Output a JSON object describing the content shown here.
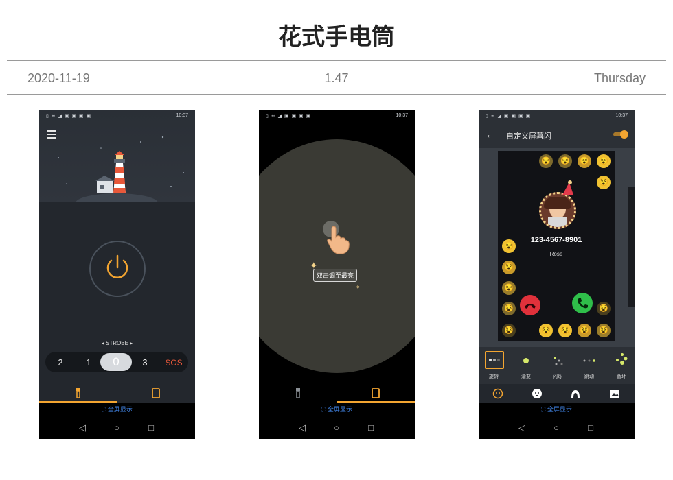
{
  "page": {
    "title": "花式手电筒",
    "date": "2020-11-19",
    "version": "1.47",
    "weekday": "Thursday"
  },
  "status_bar": {
    "icons": "▯ ≋ ◢ ▣ ▣ ▣ ▣",
    "time": "10:37"
  },
  "colors": {
    "accent": "#f3a531",
    "dark_bg": "#23272d",
    "fullscreen_link": "#3d7bd6"
  },
  "screen1": {
    "mode_label": "◂ STROBE ▸",
    "levels": [
      "2",
      "1",
      "0",
      "3",
      "SOS"
    ],
    "selected_level": "0",
    "tabs": [
      "flashlight-tab",
      "screen-light-tab"
    ],
    "fullscreen_label": "全屏显示"
  },
  "screen2": {
    "hint": "双击调至最亮",
    "fullscreen_label": "全屏显示"
  },
  "screen3": {
    "title": "自定义屏幕闪",
    "phone_number": "123-4567-8901",
    "caller_name": "Rose",
    "effects": [
      "旋转",
      "渐变",
      "闪烁",
      "跳动",
      "循环"
    ],
    "bottom_tabs": [
      "emoji-pack-icon",
      "face-icon",
      "avatar-icon",
      "image-icon"
    ],
    "fullscreen_label": "全屏显示"
  },
  "sys_nav": {
    "back": "◁",
    "home": "○",
    "recents": "□"
  }
}
